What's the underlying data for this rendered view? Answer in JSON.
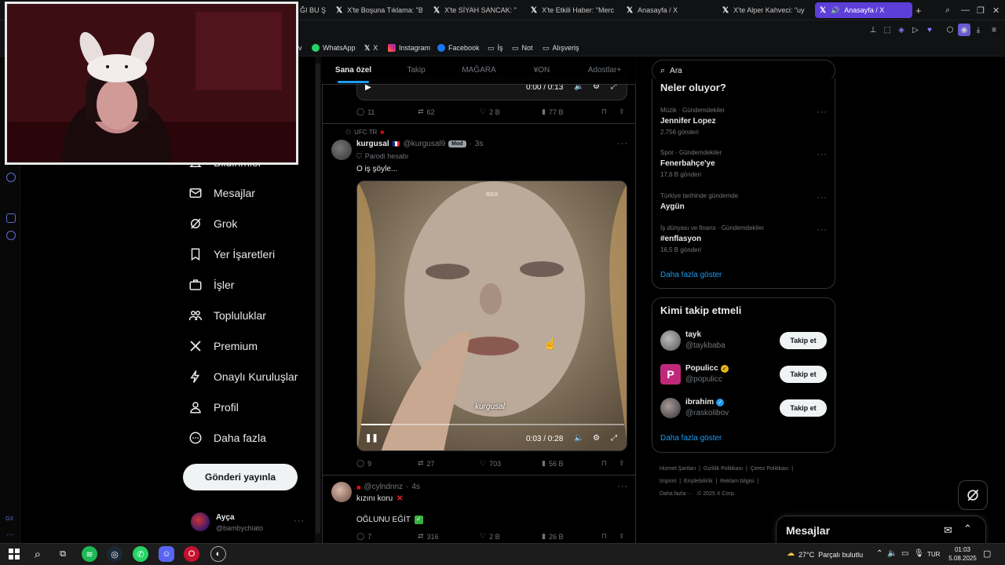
{
  "browser": {
    "tabs": [
      {
        "label": "ĞI BU Ş"
      },
      {
        "label": "X'te Boşuna Tıklama: \"B"
      },
      {
        "label": "X'te SİYAH SANCAK: \""
      },
      {
        "label": "X'te Etkili Haber: \"Merc"
      },
      {
        "label": "Anasayfa / X"
      },
      {
        "label": "X'te Alper Kahveci: \"uy"
      },
      {
        "label": "Anasayfa / X"
      }
    ],
    "bookmarks": [
      {
        "label": "v"
      },
      {
        "label": "WhatsApp"
      },
      {
        "label": "X"
      },
      {
        "label": "Instagram"
      },
      {
        "label": "Facebook"
      },
      {
        "label": "İş"
      },
      {
        "label": "Not"
      },
      {
        "label": "Alışveriş"
      }
    ]
  },
  "sidebar": {
    "items": [
      {
        "label": "Bildirimler"
      },
      {
        "label": "Mesajlar"
      },
      {
        "label": "Grok"
      },
      {
        "label": "Yer İşaretleri"
      },
      {
        "label": "İşler"
      },
      {
        "label": "Topluluklar"
      },
      {
        "label": "Premium"
      },
      {
        "label": "Onaylı Kuruluşlar"
      },
      {
        "label": "Profil"
      },
      {
        "label": "Daha fazla"
      }
    ],
    "post_button": "Gönderi yayınla",
    "account": {
      "name": "Ayça",
      "handle": "@bambychiato"
    },
    "strip_label": "GX"
  },
  "feed": {
    "tabs": [
      "Sana özel",
      "Takip",
      "MAĞARA",
      "¥ON",
      "Adostlar+"
    ],
    "prev_post": {
      "video_time": "0:00 / 0:13",
      "replies": "11",
      "reposts": "62",
      "likes": "2 B",
      "views": "77 B"
    },
    "post": {
      "community": "UFC TR",
      "author": "kurgusal",
      "handle": "@kurgusal9",
      "badge": "Mod",
      "time": "3s",
      "parody": "Parodi hesabı",
      "text": "O iş şöyle...",
      "video_watermark": "RGX",
      "caption": "kurgusal",
      "video_time": "0:03 / 0:28",
      "progress": 0.11,
      "replies": "9",
      "reposts": "27",
      "likes": "703",
      "views": "56 B"
    },
    "post2": {
      "handle": "@cylndnnz",
      "time": "4s",
      "line1": "kızını koru",
      "line2": "OĞLUNU EĞİT",
      "replies": "7",
      "reposts": "316",
      "likes": "2 B",
      "views": "26 B"
    }
  },
  "right": {
    "search_placeholder": "Ara",
    "trends_title": "Neler oluyor?",
    "trends": [
      {
        "meta": "Müzik · Gündemdekiler",
        "title": "Jennifer Lopez",
        "count": "2.756 gönderi"
      },
      {
        "meta": "Spor · Gündemdekiler",
        "title": "Fenerbahçe'ye",
        "count": "17,6 B gönderi"
      },
      {
        "meta": "Türkiye tarihinde gündemde",
        "title": "Aygün",
        "count": ""
      },
      {
        "meta": "İş dünyası ve finans · Gündemdekiler",
        "title": "#enflasyon",
        "count": "16,5 B gönderi"
      }
    ],
    "show_more": "Daha fazla göster",
    "who_title": "Kimi takip etmeli",
    "who": [
      {
        "name": "tayk",
        "handle": "@taykbaba",
        "button": "Takip et"
      },
      {
        "name": "Populicc",
        "handle": "@populicc",
        "button": "Takip et"
      },
      {
        "name": "ibrahim",
        "handle": "@raskolibov",
        "button": "Takip et"
      }
    ],
    "who_more": "Daha fazla göster",
    "footer": [
      "Hizmet Şartları",
      "Gizlilik Politikası",
      "Çerez Politikası",
      "Imprint",
      "Erişilebilirlik",
      "Reklam bilgisi",
      "Daha fazla ···",
      "© 2025 X Corp."
    ],
    "messages_title": "Mesajlar"
  },
  "taskbar": {
    "weather": "27°C  Parçalı bulutlu",
    "lang": "TUR",
    "time": "01:03",
    "date": "5.08.2025"
  },
  "colors": {
    "accent": "#1d9bf0",
    "active_tab": "#5c3fd8"
  }
}
